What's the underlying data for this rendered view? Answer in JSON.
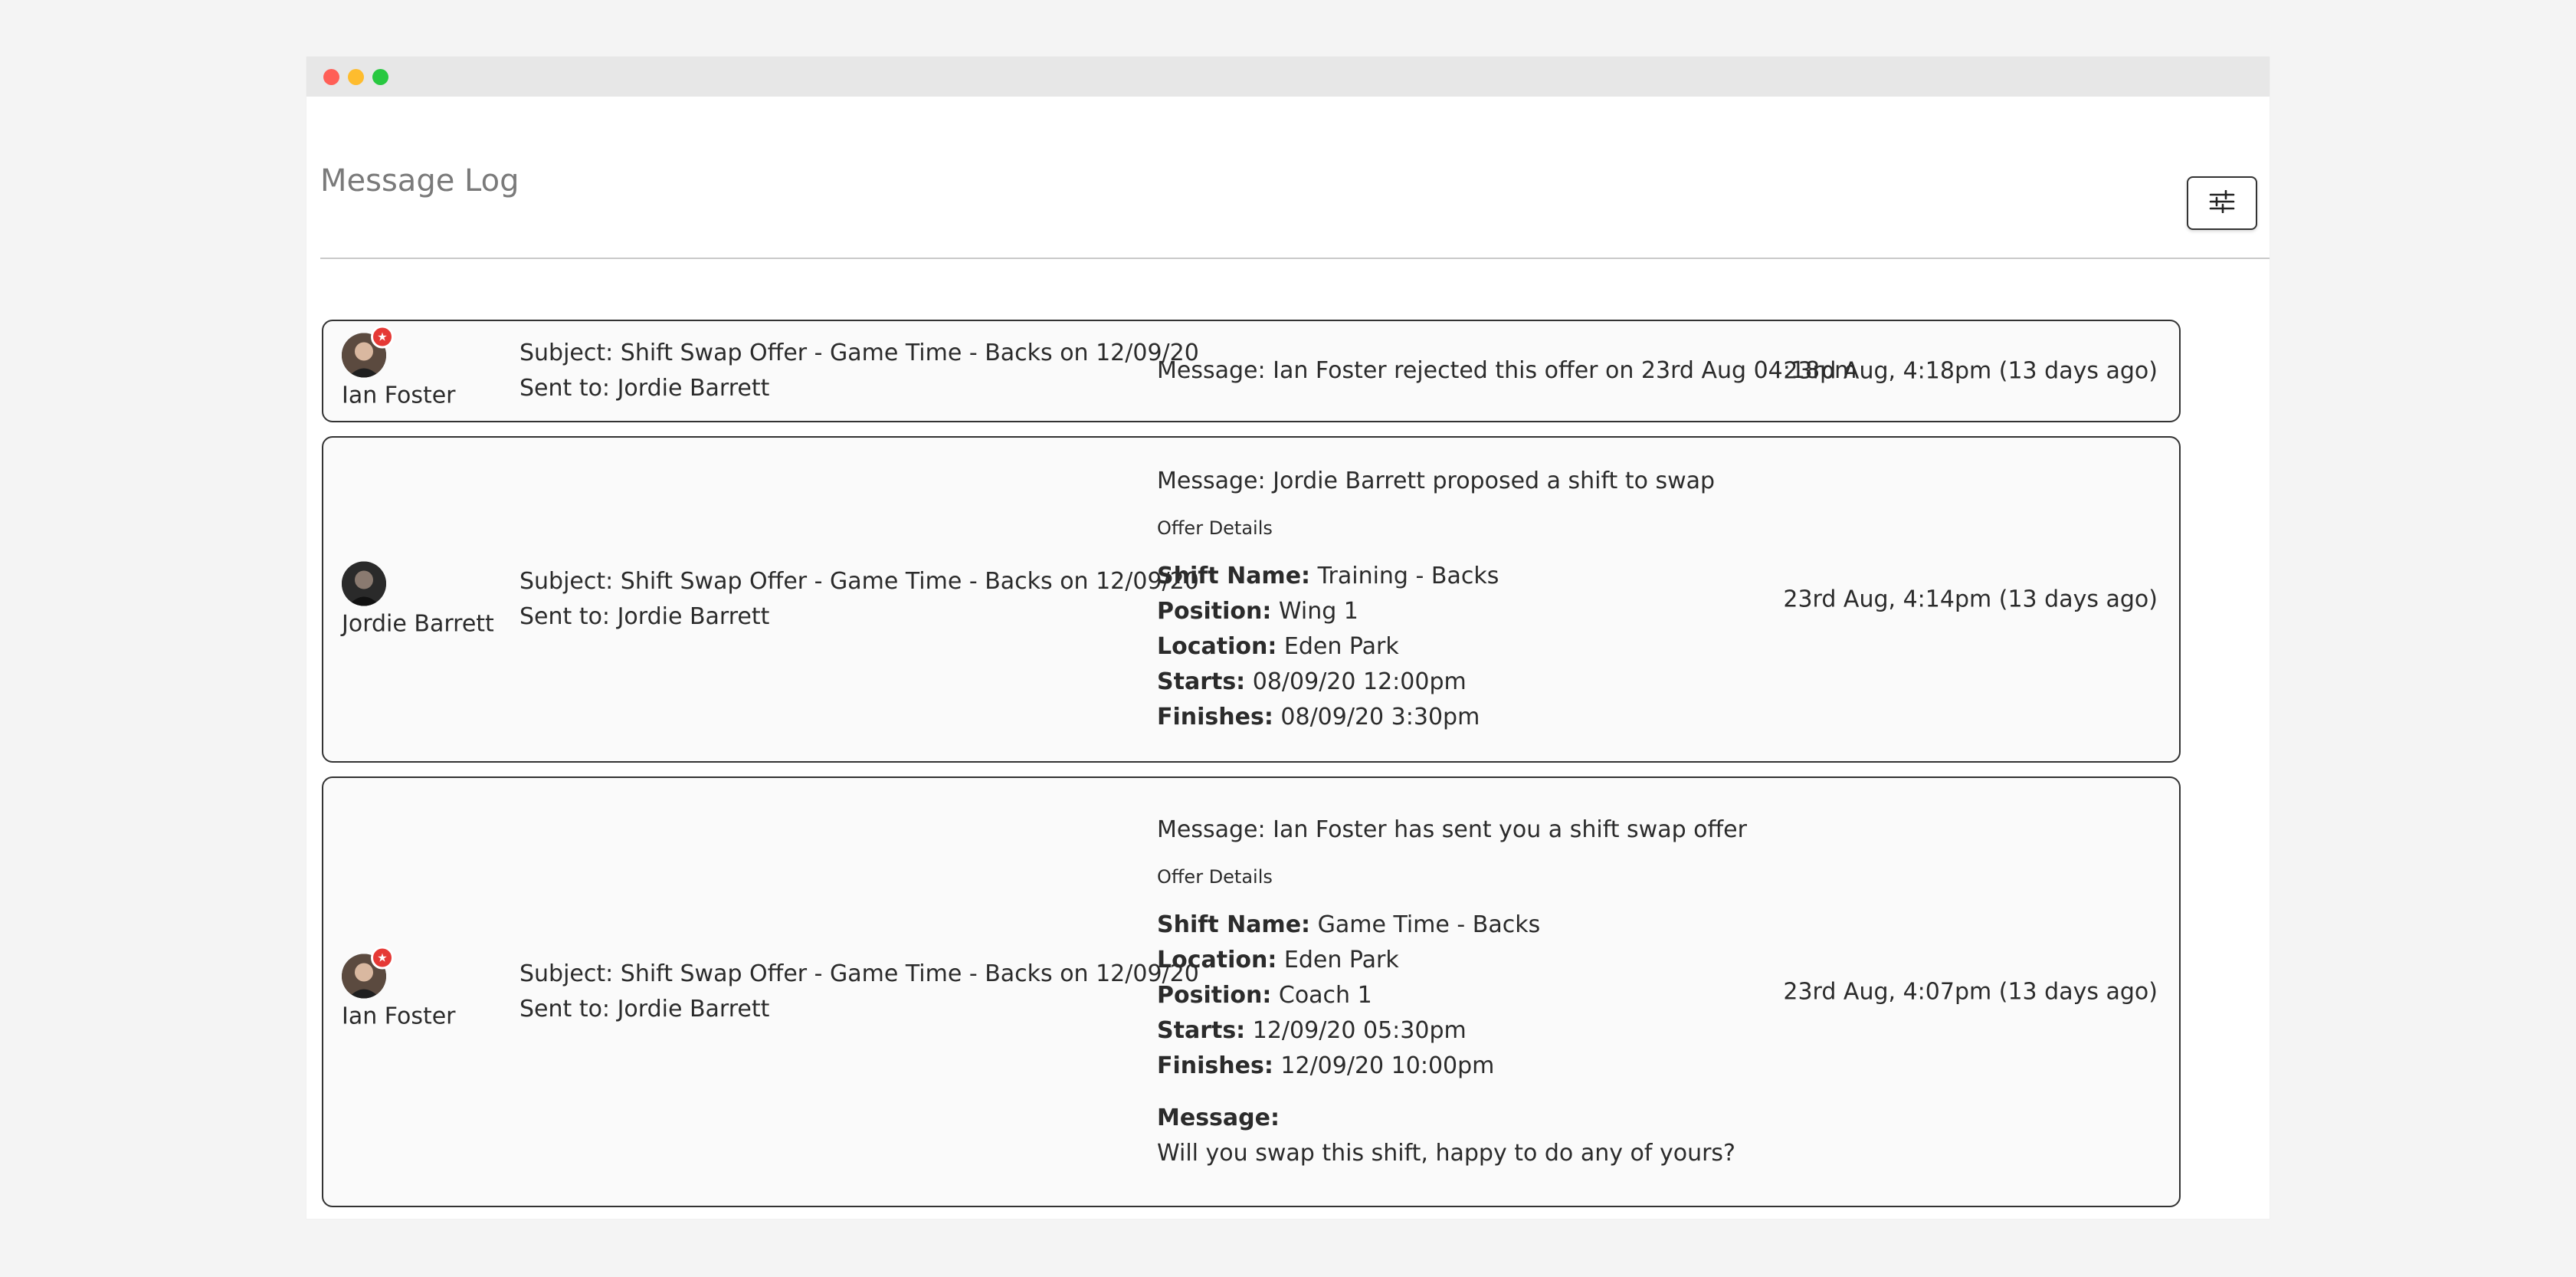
{
  "page": {
    "title": "Message Log",
    "filter_icon": "sliders-icon"
  },
  "entries": [
    {
      "author": "Ian Foster",
      "avatar_badge": true,
      "subject": "Subject: Shift Swap Offer - Game Time - Backs on 12/09/20",
      "sent_to": "Sent to: Jordie Barrett",
      "message": "Message: Ian Foster rejected this offer on 23rd Aug 04:18pm",
      "time": "23rd Aug, 4:18pm (13 days ago)"
    },
    {
      "author": "Jordie Barrett",
      "avatar_badge": false,
      "subject": "Subject: Shift Swap Offer - Game Time - Backs on 12/09/20",
      "sent_to": "Sent to: Jordie Barrett",
      "message": "Message: Jordie Barrett proposed a shift to swap",
      "offer_title": "Offer Details",
      "details": [
        {
          "label": "Shift Name:",
          "value": "Training - Backs"
        },
        {
          "label": "Position:",
          "value": "Wing 1"
        },
        {
          "label": "Location:",
          "value": "Eden Park"
        },
        {
          "label": "Starts:",
          "value": "08/09/20 12:00pm"
        },
        {
          "label": "Finishes:",
          "value": "08/09/20 3:30pm"
        }
      ],
      "time": "23rd Aug, 4:14pm (13 days ago)"
    },
    {
      "author": "Ian Foster",
      "avatar_badge": true,
      "subject": "Subject: Shift Swap Offer - Game Time - Backs on 12/09/20",
      "sent_to": "Sent to: Jordie Barrett",
      "message": "Message: Ian Foster has sent you a shift swap offer",
      "offer_title": "Offer Details",
      "details": [
        {
          "label": "Shift Name:",
          "value": "Game Time - Backs"
        },
        {
          "label": "Location:",
          "value": "Eden Park"
        },
        {
          "label": "Position:",
          "value": "Coach 1"
        },
        {
          "label": "Starts:",
          "value": "12/09/20 05:30pm"
        },
        {
          "label": "Finishes:",
          "value": "12/09/20 10:00pm"
        }
      ],
      "extra_message_label": "Message:",
      "extra_message": "Will you swap this shift, happy to do any of yours?",
      "time": "23rd Aug, 4:07pm (13 days ago)"
    }
  ]
}
